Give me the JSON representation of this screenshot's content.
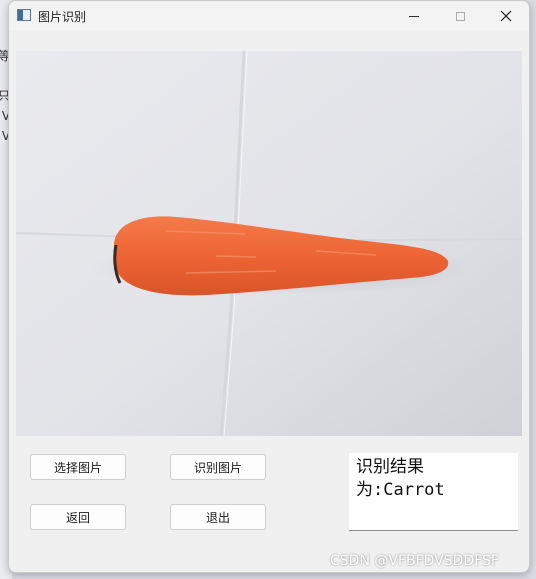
{
  "window": {
    "title": "图片识别"
  },
  "background_console": {
    "lines": [
      "等",
      "",
      "只",
      " V",
      " V"
    ]
  },
  "controls": {
    "select_label": "选择图片",
    "recognize_label": "识别图片",
    "back_label": "返回",
    "exit_label": "退出"
  },
  "result": {
    "line1": "识别结果",
    "line2": "为:Carrot"
  },
  "watermark": "CSDN @VFBFDVSDDFSF",
  "colors": {
    "carrot": "#f0683a",
    "window_bg": "#f0f0f0"
  }
}
